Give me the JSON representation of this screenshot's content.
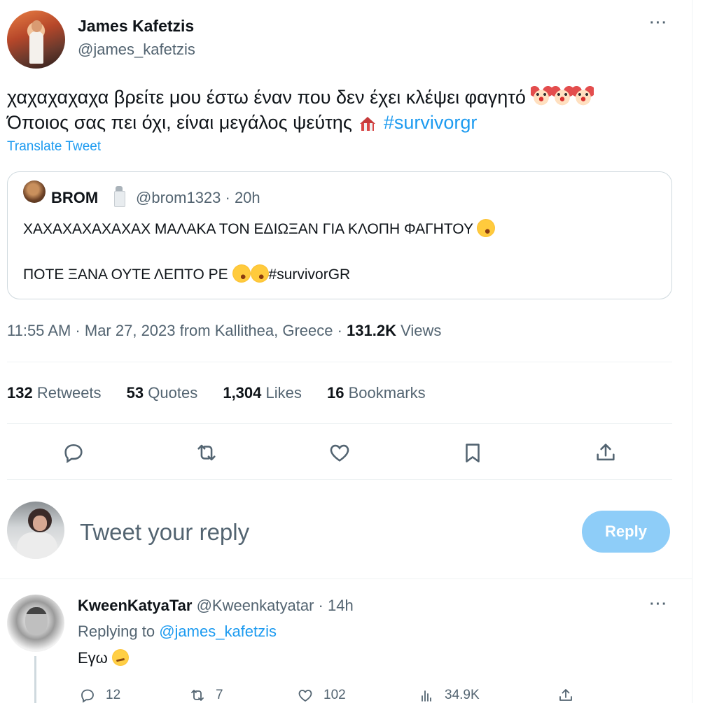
{
  "tweet": {
    "author_name": "James Kafetzis",
    "author_handle": "@james_kafetzis",
    "text_line1": "χαχαχαχαχα βρείτε μου έστω έναν που δεν έχει κλέψει φαγητό",
    "text_line2": "Όποιος σας πει όχι, είναι μεγάλος ψεύτης",
    "hashtag": "#survivorgr",
    "translate": "Translate Tweet",
    "more_icon": "more-horizontal-icon",
    "emojis_line1": [
      "clown-face",
      "clown-face",
      "clown-face"
    ],
    "emoji_line2": "circus-tent"
  },
  "quoted": {
    "name": "BROM",
    "handle_time": "@brom1323 · 20h",
    "line1": "ΧΑΧΑΧΑΧΑΧΑΧΑΧ ΜΑΛΑΚΑ ΤΟΝ ΕΔΙΩΞΑΝ ΓΙΑ ΚΛΟΠΗ ΦΑΓΗΤΟΥ",
    "line2_text": "ΠΟΤΕ ΞΑΝΑ ΟΥΤΕ ΛΕΠΤΟ ΡΕ",
    "line2_hashtag": "#survivorGR"
  },
  "meta": {
    "timestamp": "11:55 AM · Mar 27, 2023 from Kallithea, Greece · ",
    "views_count": "131.2K",
    "views_label": " Views"
  },
  "stats": [
    {
      "count": "132",
      "label": " Retweets"
    },
    {
      "count": "53",
      "label": " Quotes"
    },
    {
      "count": "1,304",
      "label": " Likes"
    },
    {
      "count": "16",
      "label": " Bookmarks"
    }
  ],
  "actions": [
    "reply-icon",
    "retweet-icon",
    "like-icon",
    "bookmark-icon",
    "share-icon"
  ],
  "composer": {
    "placeholder": "Tweet your reply",
    "button": "Reply"
  },
  "reply": {
    "name": "KweenKatyaTar",
    "handle_time": "@Kweenkatyatar · 14h",
    "replying_prefix": "Replying to ",
    "replying_handle": "@james_kafetzis",
    "text": "Εγω",
    "emoji": "smirking-face",
    "reply_count": "12",
    "retweet_count": "7",
    "like_count": "102",
    "views_count": "34.9K"
  },
  "colors": {
    "accent": "#1d9bf0",
    "muted": "#536471",
    "reply_button": "#8ecdf8",
    "border": "#cfd9de"
  }
}
